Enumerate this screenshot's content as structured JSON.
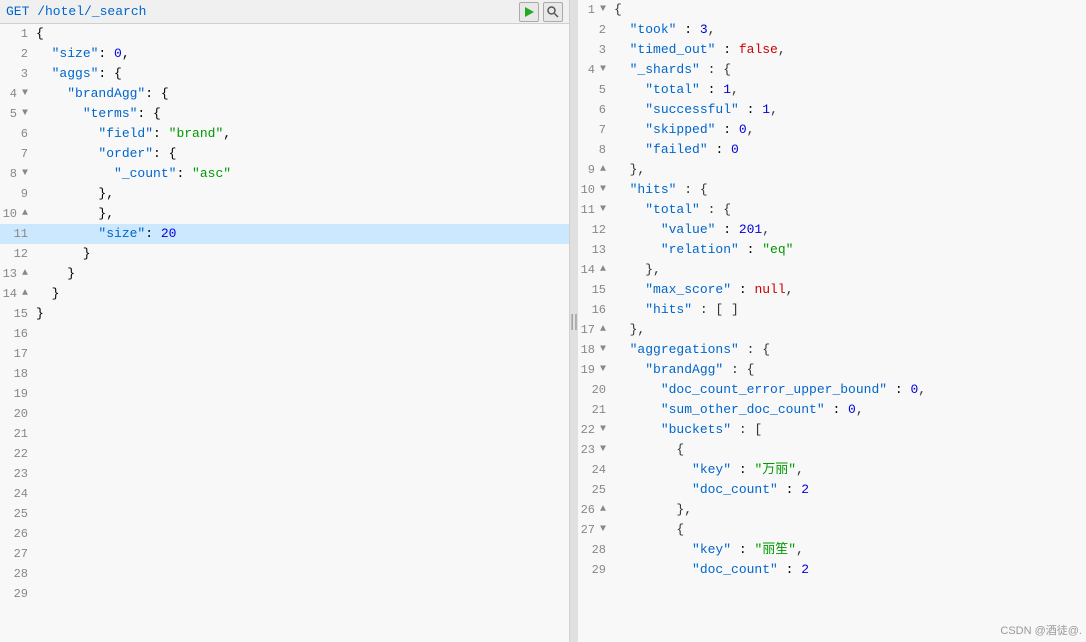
{
  "left": {
    "header": "GET /hotel/_search",
    "lines": [
      {
        "num": "1",
        "fold": "",
        "indent": "",
        "content": "{",
        "highlight": false
      },
      {
        "num": "2",
        "fold": "",
        "indent": "  ",
        "content": "\"size\": 0,",
        "highlight": false
      },
      {
        "num": "3",
        "fold": "",
        "indent": "  ",
        "content": "\"aggs\": {",
        "highlight": false
      },
      {
        "num": "4",
        "fold": "▼",
        "indent": "    ",
        "content": "\"brandAgg\": {",
        "highlight": false
      },
      {
        "num": "5",
        "fold": "▼",
        "indent": "      ",
        "content": "\"terms\": {",
        "highlight": false
      },
      {
        "num": "6",
        "fold": "",
        "indent": "        ",
        "content": "\"field\": \"brand\",",
        "highlight": false
      },
      {
        "num": "7",
        "fold": "",
        "indent": "        ",
        "content": "\"order\": {",
        "highlight": false
      },
      {
        "num": "8",
        "fold": "▼",
        "indent": "          ",
        "content": "\"_count\": \"asc\"",
        "highlight": false
      },
      {
        "num": "9",
        "fold": "",
        "indent": "        ",
        "content": "},",
        "highlight": false
      },
      {
        "num": "10",
        "fold": "▲",
        "indent": "        ",
        "content": "},",
        "highlight": false
      },
      {
        "num": "11",
        "fold": "",
        "indent": "        ",
        "content": "\"size\": 20",
        "highlight": true
      },
      {
        "num": "12",
        "fold": "",
        "indent": "      ",
        "content": "}",
        "highlight": false
      },
      {
        "num": "13",
        "fold": "▲",
        "indent": "    ",
        "content": "}",
        "highlight": false
      },
      {
        "num": "14",
        "fold": "▲",
        "indent": "  ",
        "content": "}",
        "highlight": false
      },
      {
        "num": "15",
        "fold": "",
        "indent": "",
        "content": "}",
        "highlight": false
      },
      {
        "num": "16",
        "fold": "",
        "indent": "",
        "content": "",
        "highlight": false
      },
      {
        "num": "17",
        "fold": "",
        "indent": "",
        "content": "",
        "highlight": false
      },
      {
        "num": "18",
        "fold": "",
        "indent": "",
        "content": "",
        "highlight": false
      },
      {
        "num": "19",
        "fold": "",
        "indent": "",
        "content": "",
        "highlight": false
      },
      {
        "num": "20",
        "fold": "",
        "indent": "",
        "content": "",
        "highlight": false
      },
      {
        "num": "21",
        "fold": "",
        "indent": "",
        "content": "",
        "highlight": false
      },
      {
        "num": "22",
        "fold": "",
        "indent": "",
        "content": "",
        "highlight": false
      },
      {
        "num": "23",
        "fold": "",
        "indent": "",
        "content": "",
        "highlight": false
      },
      {
        "num": "24",
        "fold": "",
        "indent": "",
        "content": "",
        "highlight": false
      },
      {
        "num": "25",
        "fold": "",
        "indent": "",
        "content": "",
        "highlight": false
      },
      {
        "num": "26",
        "fold": "",
        "indent": "",
        "content": "",
        "highlight": false
      },
      {
        "num": "27",
        "fold": "",
        "indent": "",
        "content": "",
        "highlight": false
      },
      {
        "num": "28",
        "fold": "",
        "indent": "",
        "content": "",
        "highlight": false
      },
      {
        "num": "29",
        "fold": "",
        "indent": "",
        "content": "",
        "highlight": false
      }
    ]
  },
  "right": {
    "lines": [
      {
        "num": "1",
        "fold": "▼",
        "tokens": [
          {
            "t": "{",
            "c": "c-punct"
          }
        ]
      },
      {
        "num": "2",
        "fold": "",
        "tokens": [
          {
            "t": "  ",
            "c": ""
          },
          {
            "t": "\"took\"",
            "c": "c-key"
          },
          {
            "t": " : ",
            "c": ""
          },
          {
            "t": "3",
            "c": "c-val-num"
          },
          {
            "t": ",",
            "c": "c-punct"
          }
        ]
      },
      {
        "num": "3",
        "fold": "",
        "tokens": [
          {
            "t": "  ",
            "c": ""
          },
          {
            "t": "\"timed_out\"",
            "c": "c-key"
          },
          {
            "t": " : ",
            "c": ""
          },
          {
            "t": "false",
            "c": "c-val-bool"
          },
          {
            "t": ",",
            "c": "c-punct"
          }
        ]
      },
      {
        "num": "4",
        "fold": "▼",
        "tokens": [
          {
            "t": "  ",
            "c": ""
          },
          {
            "t": "\"_shards\"",
            "c": "c-key"
          },
          {
            "t": " : {",
            "c": "c-punct"
          }
        ]
      },
      {
        "num": "5",
        "fold": "",
        "tokens": [
          {
            "t": "    ",
            "c": ""
          },
          {
            "t": "\"total\"",
            "c": "c-key"
          },
          {
            "t": " : ",
            "c": ""
          },
          {
            "t": "1",
            "c": "c-val-num"
          },
          {
            "t": ",",
            "c": "c-punct"
          }
        ]
      },
      {
        "num": "6",
        "fold": "",
        "tokens": [
          {
            "t": "    ",
            "c": ""
          },
          {
            "t": "\"successful\"",
            "c": "c-key"
          },
          {
            "t": " : ",
            "c": ""
          },
          {
            "t": "1",
            "c": "c-val-num"
          },
          {
            "t": ",",
            "c": "c-punct"
          }
        ]
      },
      {
        "num": "7",
        "fold": "",
        "tokens": [
          {
            "t": "    ",
            "c": ""
          },
          {
            "t": "\"skipped\"",
            "c": "c-key"
          },
          {
            "t": " : ",
            "c": ""
          },
          {
            "t": "0",
            "c": "c-val-num"
          },
          {
            "t": ",",
            "c": "c-punct"
          }
        ]
      },
      {
        "num": "8",
        "fold": "",
        "tokens": [
          {
            "t": "    ",
            "c": ""
          },
          {
            "t": "\"failed\"",
            "c": "c-key"
          },
          {
            "t": " : ",
            "c": ""
          },
          {
            "t": "0",
            "c": "c-val-num"
          }
        ]
      },
      {
        "num": "9",
        "fold": "▲",
        "tokens": [
          {
            "t": "  ",
            "c": ""
          },
          {
            "t": "},",
            "c": "c-punct"
          }
        ]
      },
      {
        "num": "10",
        "fold": "▼",
        "tokens": [
          {
            "t": "  ",
            "c": ""
          },
          {
            "t": "\"hits\"",
            "c": "c-key"
          },
          {
            "t": " : {",
            "c": "c-punct"
          }
        ]
      },
      {
        "num": "11",
        "fold": "▼",
        "tokens": [
          {
            "t": "    ",
            "c": ""
          },
          {
            "t": "\"total\"",
            "c": "c-key"
          },
          {
            "t": " : {",
            "c": "c-punct"
          }
        ]
      },
      {
        "num": "12",
        "fold": "",
        "tokens": [
          {
            "t": "      ",
            "c": ""
          },
          {
            "t": "\"value\"",
            "c": "c-key"
          },
          {
            "t": " : ",
            "c": ""
          },
          {
            "t": "201",
            "c": "c-val-num"
          },
          {
            "t": ",",
            "c": "c-punct"
          }
        ]
      },
      {
        "num": "13",
        "fold": "",
        "tokens": [
          {
            "t": "      ",
            "c": ""
          },
          {
            "t": "\"relation\"",
            "c": "c-key"
          },
          {
            "t": " : ",
            "c": ""
          },
          {
            "t": "\"eq\"",
            "c": "c-val-str"
          }
        ]
      },
      {
        "num": "14",
        "fold": "▲",
        "tokens": [
          {
            "t": "    ",
            "c": ""
          },
          {
            "t": "},",
            "c": "c-punct"
          }
        ]
      },
      {
        "num": "15",
        "fold": "",
        "tokens": [
          {
            "t": "    ",
            "c": ""
          },
          {
            "t": "\"max_score\"",
            "c": "c-key"
          },
          {
            "t": " : ",
            "c": ""
          },
          {
            "t": "null",
            "c": "c-val-bool"
          },
          {
            "t": ",",
            "c": "c-punct"
          }
        ]
      },
      {
        "num": "16",
        "fold": "",
        "tokens": [
          {
            "t": "    ",
            "c": ""
          },
          {
            "t": "\"hits\"",
            "c": "c-key"
          },
          {
            "t": " : [ ]",
            "c": "c-punct"
          }
        ]
      },
      {
        "num": "17",
        "fold": "▲",
        "tokens": [
          {
            "t": "  ",
            "c": ""
          },
          {
            "t": "},",
            "c": "c-punct"
          }
        ]
      },
      {
        "num": "18",
        "fold": "▼",
        "tokens": [
          {
            "t": "  ",
            "c": ""
          },
          {
            "t": "\"aggregations\"",
            "c": "c-key"
          },
          {
            "t": " : {",
            "c": "c-punct"
          }
        ]
      },
      {
        "num": "19",
        "fold": "▼",
        "tokens": [
          {
            "t": "    ",
            "c": ""
          },
          {
            "t": "\"brandAgg\"",
            "c": "c-key"
          },
          {
            "t": " : {",
            "c": "c-punct"
          }
        ]
      },
      {
        "num": "20",
        "fold": "",
        "tokens": [
          {
            "t": "      ",
            "c": ""
          },
          {
            "t": "\"doc_count_error_upper_bound\"",
            "c": "c-key"
          },
          {
            "t": " : ",
            "c": ""
          },
          {
            "t": "0",
            "c": "c-val-num"
          },
          {
            "t": ",",
            "c": "c-punct"
          }
        ]
      },
      {
        "num": "21",
        "fold": "",
        "tokens": [
          {
            "t": "      ",
            "c": ""
          },
          {
            "t": "\"sum_other_doc_count\"",
            "c": "c-key"
          },
          {
            "t": " : ",
            "c": ""
          },
          {
            "t": "0",
            "c": "c-val-num"
          },
          {
            "t": ",",
            "c": "c-punct"
          }
        ]
      },
      {
        "num": "22",
        "fold": "▼",
        "tokens": [
          {
            "t": "      ",
            "c": ""
          },
          {
            "t": "\"buckets\"",
            "c": "c-key"
          },
          {
            "t": " : [",
            "c": "c-punct"
          }
        ]
      },
      {
        "num": "23",
        "fold": "▼",
        "tokens": [
          {
            "t": "        ",
            "c": ""
          },
          {
            "t": "{",
            "c": "c-punct"
          }
        ]
      },
      {
        "num": "24",
        "fold": "",
        "tokens": [
          {
            "t": "          ",
            "c": ""
          },
          {
            "t": "\"key\"",
            "c": "c-key"
          },
          {
            "t": " : ",
            "c": ""
          },
          {
            "t": "\"万丽\"",
            "c": "c-val-str"
          },
          {
            "t": ",",
            "c": "c-punct"
          }
        ]
      },
      {
        "num": "25",
        "fold": "",
        "tokens": [
          {
            "t": "          ",
            "c": ""
          },
          {
            "t": "\"doc_count\"",
            "c": "c-key"
          },
          {
            "t": " : ",
            "c": ""
          },
          {
            "t": "2",
            "c": "c-val-num"
          }
        ]
      },
      {
        "num": "26",
        "fold": "▲",
        "tokens": [
          {
            "t": "        ",
            "c": ""
          },
          {
            "t": "},",
            "c": "c-punct"
          }
        ]
      },
      {
        "num": "27",
        "fold": "▼",
        "tokens": [
          {
            "t": "        ",
            "c": ""
          },
          {
            "t": "{",
            "c": "c-punct"
          }
        ]
      },
      {
        "num": "28",
        "fold": "",
        "tokens": [
          {
            "t": "          ",
            "c": ""
          },
          {
            "t": "\"key\"",
            "c": "c-key"
          },
          {
            "t": " : ",
            "c": ""
          },
          {
            "t": "\"丽笙\"",
            "c": "c-val-str"
          },
          {
            "t": ",",
            "c": "c-punct"
          }
        ]
      },
      {
        "num": "29",
        "fold": "",
        "tokens": [
          {
            "t": "          ",
            "c": ""
          },
          {
            "t": "\"doc_count\"",
            "c": "c-key"
          },
          {
            "t": " : ",
            "c": ""
          },
          {
            "t": "2",
            "c": "c-val-num"
          }
        ]
      }
    ]
  },
  "watermark": "CSDN @酒徒@.",
  "icons": {
    "run": "▶",
    "search": "🔍"
  }
}
